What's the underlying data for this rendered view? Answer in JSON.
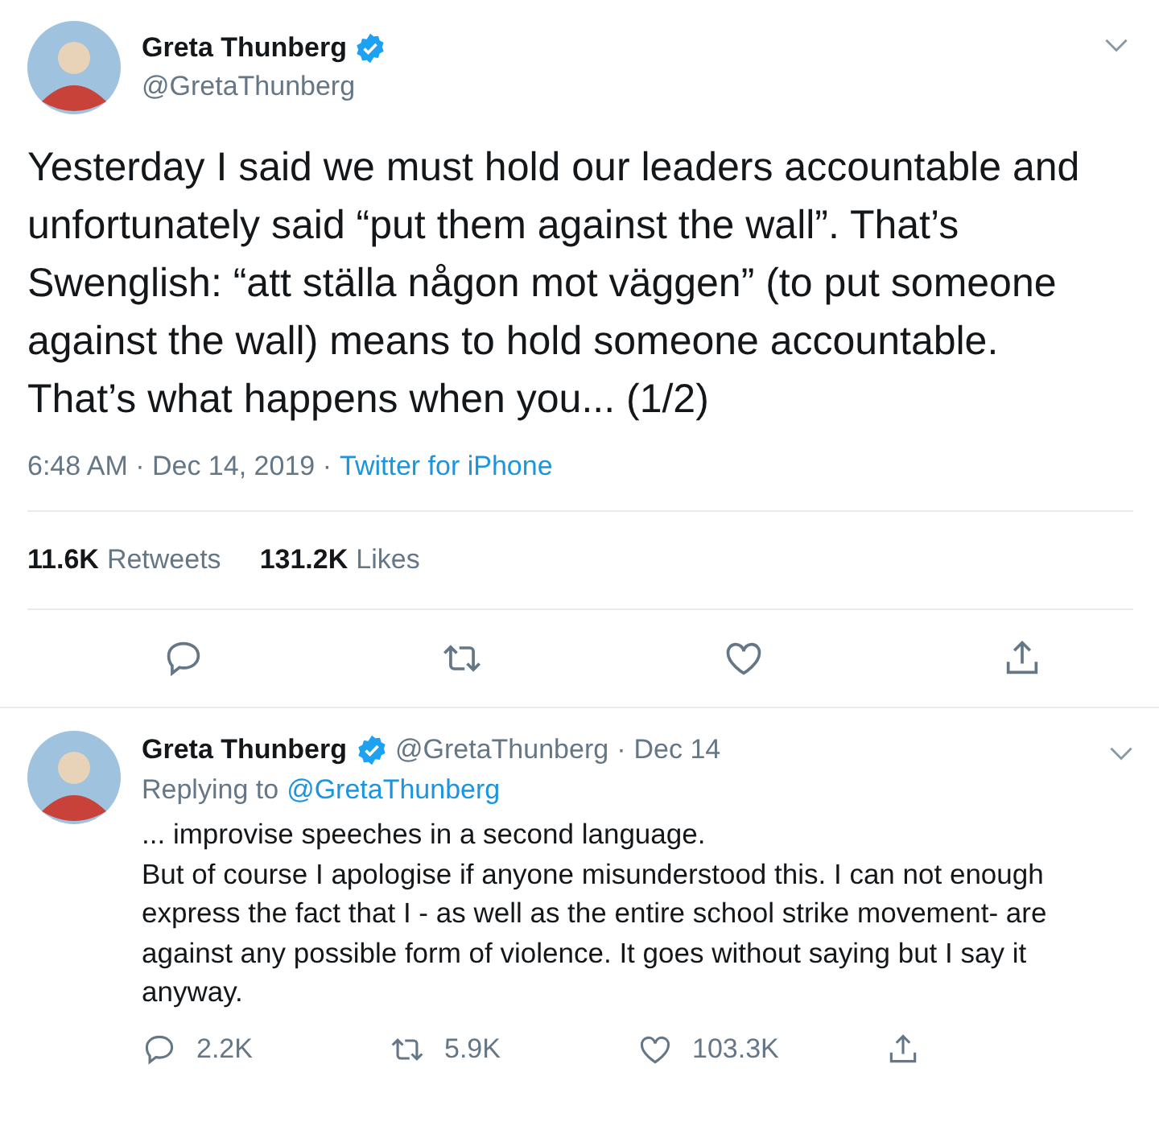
{
  "tweet": {
    "author": {
      "name": "Greta Thunberg",
      "handle": "@GretaThunberg",
      "verified": true
    },
    "text": "Yesterday I said we must hold our leaders accountable and unfortunately said “put them against the wall”. That’s Swenglish: “att ställa någon mot väggen” (to put someone against the wall) means to hold someone accountable.\nThat’s what happens when you... (1/2)",
    "timestamp": "6:48 AM · Dec 14, 2019 ·",
    "source": "Twitter for iPhone",
    "stats": [
      {
        "count": "11.6K",
        "label": "Retweets"
      },
      {
        "count": "131.2K",
        "label": "Likes"
      }
    ],
    "actions": [
      {
        "kind": "reply"
      },
      {
        "kind": "retweet"
      },
      {
        "kind": "like"
      },
      {
        "kind": "share"
      }
    ]
  },
  "reply": {
    "author": {
      "name": "Greta Thunberg",
      "handle": "@GretaThunberg",
      "verified": true
    },
    "separator": "·",
    "date": "Dec 14",
    "replying_label": "Replying to",
    "replying_to": "@GretaThunberg",
    "text": "... improvise speeches in a second language.\nBut of course I apologise if anyone misunderstood this. I can not enough express the fact that I - as well as the entire school strike movement- are against any possible form of violence. It goes without saying but I say it anyway.",
    "actions": [
      {
        "kind": "reply",
        "count": "2.2K"
      },
      {
        "kind": "retweet",
        "count": "5.9K"
      },
      {
        "kind": "like",
        "count": "103.3K"
      },
      {
        "kind": "share"
      }
    ]
  }
}
